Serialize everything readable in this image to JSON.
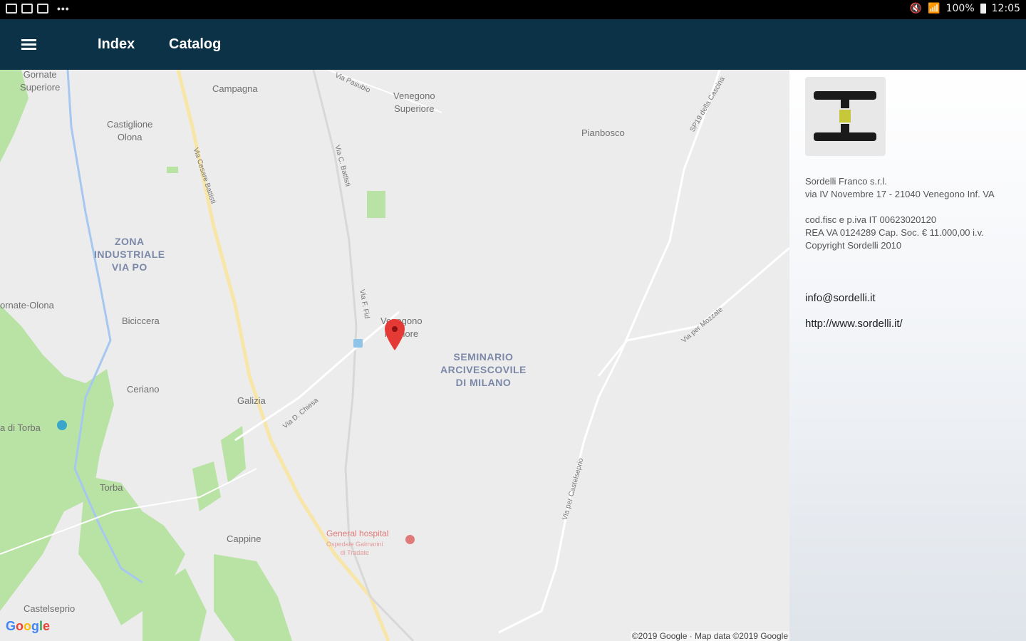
{
  "status_bar": {
    "left_icons": [
      "gallery-icon",
      "mail-icon",
      "image-icon"
    ],
    "right": {
      "battery": "100%",
      "time": "12:05"
    }
  },
  "app_bar": {
    "menu_icon": "hamburger-icon",
    "nav": [
      {
        "label": "Index"
      },
      {
        "label": "Catalog"
      }
    ]
  },
  "map": {
    "labels": {
      "gornate_superiore": "Gornate\nSuperiore",
      "campagna": "Campagna",
      "venegono_superiore": "Venegono\nSuperiore",
      "castiglione_olona": "Castiglione\nOlona",
      "pianbosco": "Pianbosco",
      "zona_industriale": "ZONA\nINDUSTRIALE\nVIA PO",
      "gornate_olona": "ornate-Olona",
      "biciccera": "Biciccera",
      "venegono_inferiore": "Venegono\nInferiore",
      "seminario": "SEMINARIO\nARCIVESCOVILE\nDI MILANO",
      "ceriano": "Ceriano",
      "galizia": "Galizia",
      "torba_place": "a di Torba",
      "torba": "Torba",
      "cappine": "Cappine",
      "castelseprio": "Castelseprio",
      "hospital": "General hospital",
      "hospital_sub": "Ospedale Galmarini\ndi Tradate"
    },
    "roads": {
      "via_pasubio": "Via Pasubio",
      "via_cesare_battisti": "Via Cesare Battisti",
      "via_c_battisti": "Via C. Battisti",
      "sp_cascina": "SP19 della Cascina",
      "via_ficelli": "Via F. Fid",
      "via_d_chiesa": "Via D. Chiesa",
      "via_per_mozzate": "Via per Mozzate",
      "via_per_castelseprio": "Via per Castelseprio"
    },
    "marker_icon": "map-pin-icon",
    "google_logo": [
      "G",
      "o",
      "o",
      "g",
      "l",
      "e"
    ],
    "attribution": "©2019 Google · Map data ©2019 Google"
  },
  "sidebar": {
    "company_name": "Sordelli Franco s.r.l.",
    "address": "via IV Novembre 17 - 21040 Venegono Inf. VA",
    "fiscal_code": "cod.fisc e p.iva IT 00623020120",
    "rea": "REA VA 0124289 Cap. Soc. € 11.000,00 i.v.",
    "copyright": "Copyright Sordelli 2010",
    "email": "info@sordelli.it",
    "website": "http://www.sordelli.it/"
  }
}
